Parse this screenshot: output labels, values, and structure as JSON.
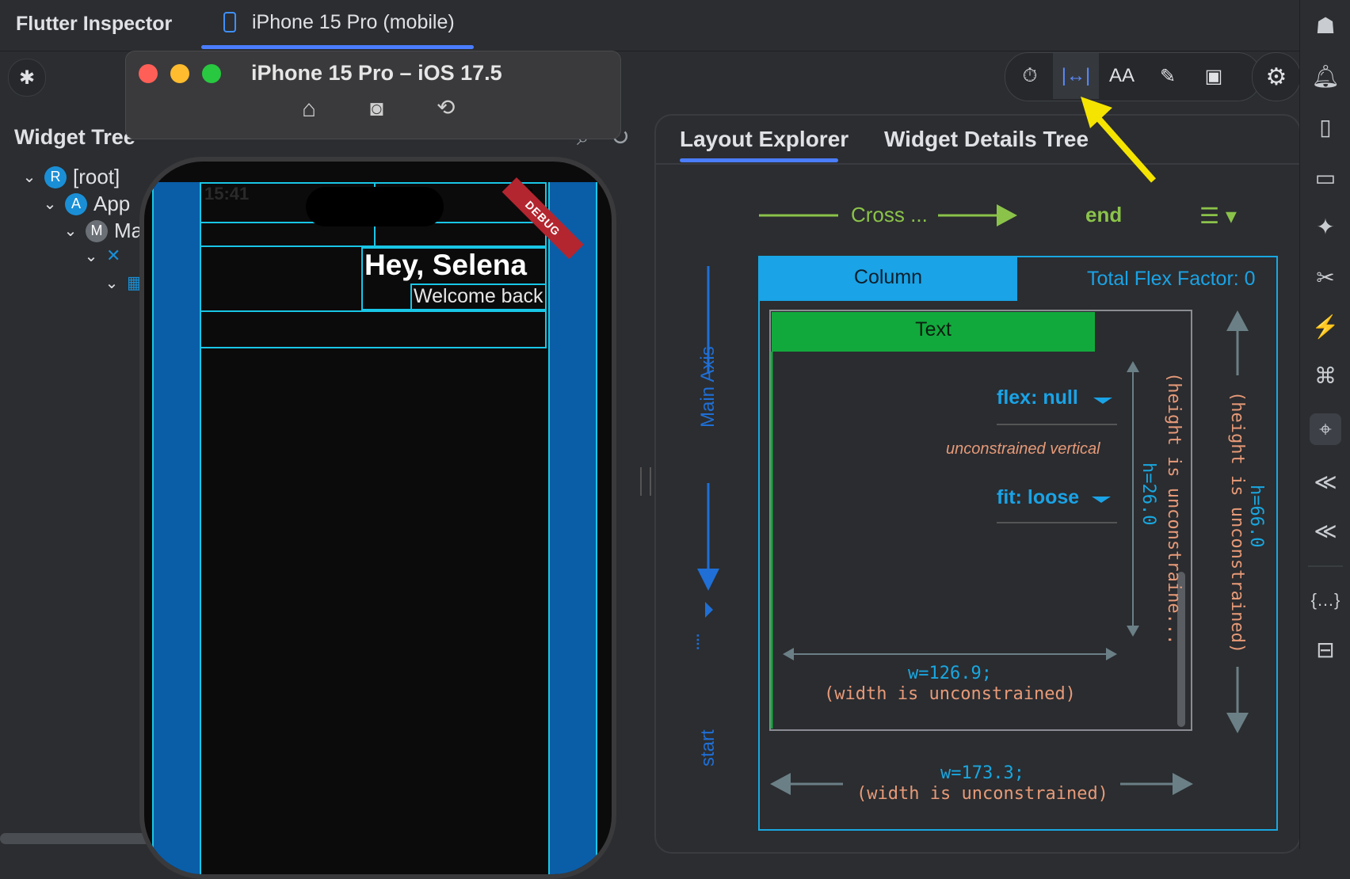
{
  "header": {
    "app_title": "Flutter Inspector",
    "device_tab": "iPhone 15 Pro (mobile)"
  },
  "simulator": {
    "title": "iPhone 15 Pro – iOS 17.5",
    "status_time": "15:41",
    "debug_banner": "DEBUG",
    "greeting": "Hey, Selena",
    "subtitle": "Welcome back"
  },
  "widget_tree": {
    "title": "Widget Tree",
    "rows": [
      {
        "badge": "R",
        "label": "[root]"
      },
      {
        "badge": "A",
        "label": "App"
      },
      {
        "badge": "M",
        "label": "Ma"
      }
    ]
  },
  "layout_explorer": {
    "tabs": [
      "Layout Explorer",
      "Widget Details Tree"
    ],
    "cross_axis_label": "Cross ...",
    "cross_axis_value": "end",
    "main_axis_label": "Main Axis",
    "main_axis_value": "start",
    "column_label": "Column",
    "total_flex": "Total Flex Factor: 0",
    "child_label": "Text",
    "flex_label": "flex: null",
    "unconstrained_note": "unconstrained vertical",
    "fit_label": "fit: loose",
    "child_height": "h=26.0",
    "child_height_note": "(height is unconstraine...",
    "child_width": "w=126.9;",
    "child_width_note": "(width is unconstrained)",
    "parent_height": "h=66.0",
    "parent_height_note": "(height is unconstrained)",
    "parent_width": "w=173.3;",
    "parent_width_note": "(width is unconstrained)"
  },
  "colors": {
    "accent_blue": "#4a7dff",
    "column_blue": "#1aa3e6",
    "text_green": "#12a93c",
    "axis_green": "#8bc34a",
    "measure_cyan": "#19a7e0",
    "note_orange": "#e79a78",
    "arrow_yellow": "#f5e400"
  }
}
